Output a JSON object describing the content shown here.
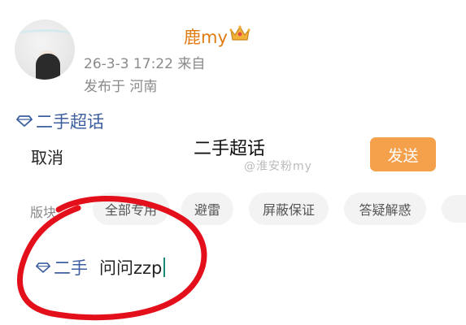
{
  "author": {
    "name": "鹿my",
    "post_time": "26-3-3 17:22 来自",
    "location": "发布于 河南"
  },
  "topic": {
    "label": "二手超话"
  },
  "sheet": {
    "cancel_label": "取消",
    "title": "二手超话",
    "send_label": "发送",
    "watermark": "@淮安粉my"
  },
  "sections": {
    "label": "版块",
    "chips": [
      "全部专用",
      "避雷",
      "屏蔽保证",
      "答疑解惑"
    ]
  },
  "compose": {
    "tag": "二手",
    "text": "问问zzp"
  },
  "colors": {
    "accent": "#f5a04a",
    "username": "#e07b12",
    "topic_link": "#3d5fa0",
    "annotation": "#e3101b"
  },
  "icons": {
    "crown": "crown-icon",
    "diamond": "diamond-icon"
  }
}
